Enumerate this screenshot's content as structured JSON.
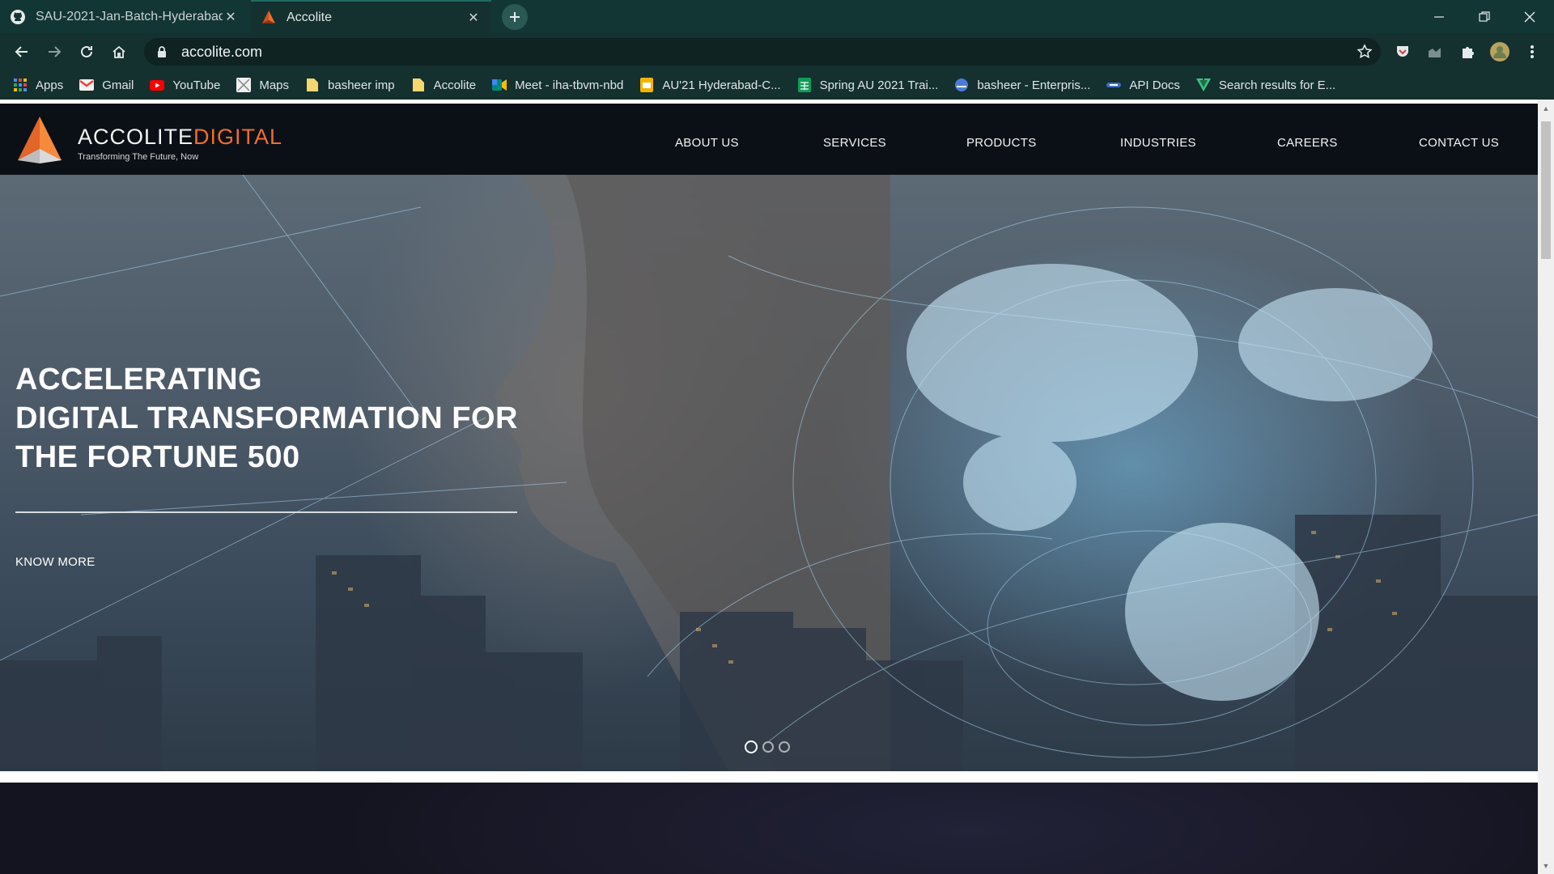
{
  "browser": {
    "tabs": [
      {
        "title": "SAU-2021-Jan-Batch-Hyderabad",
        "icon": "github-icon",
        "active": false
      },
      {
        "title": "Accolite",
        "icon": "accolite-favicon",
        "active": true
      }
    ],
    "address": "accolite.com",
    "bookmarks": [
      {
        "label": "Apps",
        "icon": "apps-grid-icon"
      },
      {
        "label": "Gmail",
        "icon": "gmail-icon"
      },
      {
        "label": "YouTube",
        "icon": "youtube-icon"
      },
      {
        "label": "Maps",
        "icon": "maps-icon"
      },
      {
        "label": "basheer imp",
        "icon": "folder-icon"
      },
      {
        "label": "Accolite",
        "icon": "folder-icon"
      },
      {
        "label": "Meet - iha-tbvm-nbd",
        "icon": "meet-icon"
      },
      {
        "label": "AU'21 Hyderabad-C...",
        "icon": "slides-icon"
      },
      {
        "label": "Spring AU 2021 Trai...",
        "icon": "sheets-icon"
      },
      {
        "label": "basheer - Enterpris...",
        "icon": "globe-icon"
      },
      {
        "label": "API Docs",
        "icon": "api-icon"
      },
      {
        "label": "Search results for E...",
        "icon": "vuetify-icon"
      }
    ],
    "accent_color": "#14302f"
  },
  "site": {
    "brand_main": "ACCOLITE",
    "brand_accent": "DIGITAL",
    "tagline": "Transforming The Future, Now",
    "nav": [
      "ABOUT US",
      "SERVICES",
      "PRODUCTS",
      "INDUSTRIES",
      "CAREERS",
      "CONTACT US"
    ],
    "hero": {
      "headline_1": "ACCELERATING",
      "headline_2": "DIGITAL TRANSFORMATION FOR",
      "headline_3": "THE FORTUNE 500",
      "cta": "KNOW MORE",
      "slide_count": 3,
      "active_slide": 1
    },
    "brand_color": "#f26c2a"
  }
}
